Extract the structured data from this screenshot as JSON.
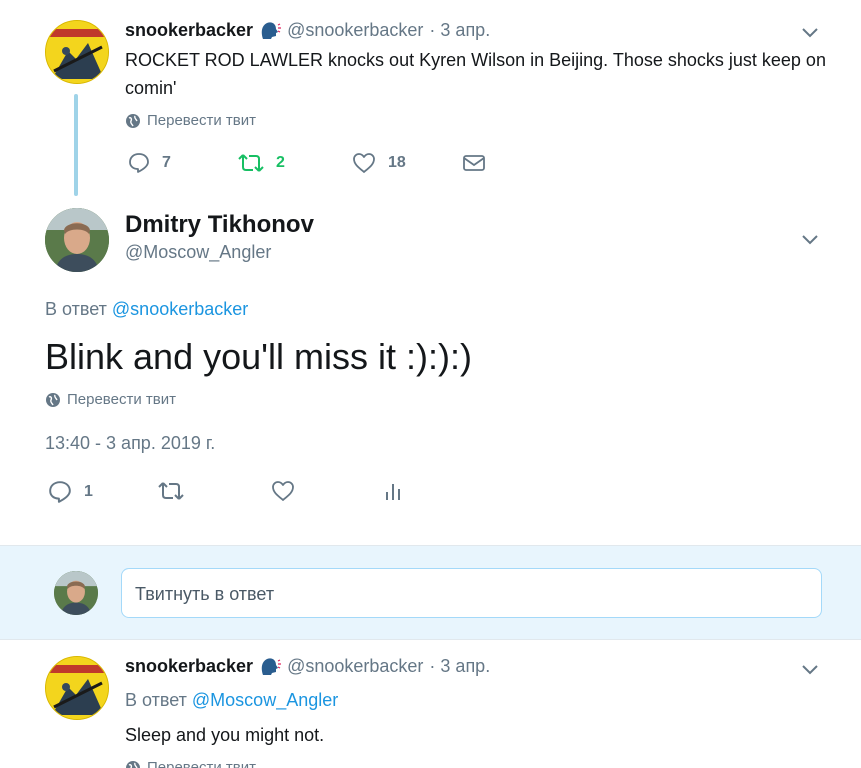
{
  "tweet1": {
    "name": "snookerbacker",
    "handle": "@snookerbacker",
    "time": "· 3 апр.",
    "text": "ROCKET ROD LAWLER knocks out Kyren Wilson in Beijing. Those shocks just keep on comin'",
    "translate": "Перевести твит",
    "replies": "7",
    "retweets": "2",
    "likes": "18",
    "avatar_text_top": "SNOOKERBACKER",
    "avatar_text_for": "for",
    "avatar_text_healthful": "HEALTHFUL",
    "avatar_text_recreation": "RECREATION"
  },
  "main": {
    "name": "Dmitry Tikhonov",
    "handle": "@Moscow_Angler",
    "reply_prefix": "В ответ",
    "reply_to": "@snookerbacker",
    "text": "Blink and you'll miss it :):):)",
    "translate": "Перевести твит",
    "timestamp": "13:40 - 3 апр. 2019 г.",
    "replies": "1"
  },
  "compose": {
    "placeholder": "Твитнуть в ответ"
  },
  "tweet2": {
    "name": "snookerbacker",
    "handle": "@snookerbacker",
    "time": "· 3 апр.",
    "reply_prefix": "В ответ",
    "reply_to": "@Moscow_Angler",
    "text": "Sleep and you might not.",
    "translate": "Перевести твит"
  },
  "colors": {
    "accent": "#1b95e0",
    "retweet": "#17bf63",
    "thread_line": "#9fd3e8",
    "muted": "#657786"
  }
}
